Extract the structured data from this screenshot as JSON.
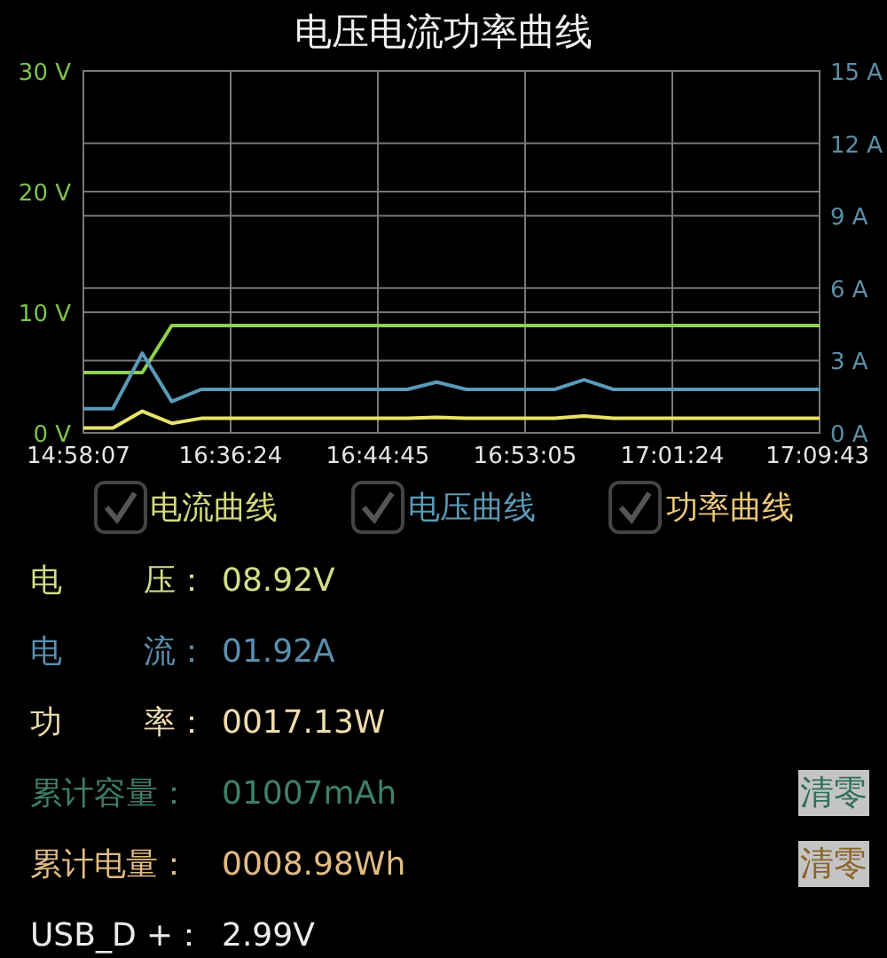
{
  "title": "电压电流功率曲线",
  "chart": {
    "chart_data": {
      "type": "line",
      "grid": true,
      "categories": [
        "14:58:07",
        null,
        null,
        null,
        null,
        "16:36:24",
        null,
        null,
        null,
        null,
        "16:44:45",
        null,
        null,
        null,
        null,
        "16:53:05",
        null,
        null,
        null,
        null,
        "17:01:24",
        null,
        null,
        null,
        null,
        "17:09:43"
      ],
      "ylim": [
        0,
        30
      ],
      "yticks": [
        {
          "value": 0,
          "label": "0 V"
        },
        {
          "value": 10,
          "label": "10 V"
        },
        {
          "value": 20,
          "label": "20 V"
        },
        {
          "value": 30,
          "label": "30 V"
        }
      ],
      "y2lim": [
        0,
        15
      ],
      "y2ticks": [
        {
          "value": 0,
          "label": "0 A"
        },
        {
          "value": 3,
          "label": "3 A"
        },
        {
          "value": 6,
          "label": "6 A"
        },
        {
          "value": 9,
          "label": "9 A"
        },
        {
          "value": 12,
          "label": "12 A"
        },
        {
          "value": 15,
          "label": "15 A"
        }
      ],
      "series": [
        {
          "color": "#8fd14f",
          "values": [
            5,
            5,
            5,
            8.9,
            8.9,
            8.9,
            8.9,
            8.9,
            8.9,
            8.9,
            8.9,
            8.9,
            8.9,
            8.9,
            8.9,
            8.9,
            8.9,
            8.9,
            8.9,
            8.9,
            8.9,
            8.9,
            8.9,
            8.9,
            8.9,
            8.9
          ]
        },
        {
          "color": "#5b9ab8",
          "axis": "y2",
          "values": [
            1.0,
            1.0,
            3.3,
            1.3,
            1.8,
            1.8,
            1.8,
            1.8,
            1.8,
            1.8,
            1.8,
            1.8,
            2.1,
            1.8,
            1.8,
            1.8,
            1.8,
            2.2,
            1.8,
            1.8,
            1.8,
            1.8,
            1.8,
            1.8,
            1.8,
            1.8
          ]
        },
        {
          "color": "#e9e36a",
          "values": [
            0.4,
            0.4,
            1.8,
            0.8,
            1.2,
            1.2,
            1.2,
            1.2,
            1.2,
            1.2,
            1.2,
            1.2,
            1.3,
            1.2,
            1.2,
            1.2,
            1.2,
            1.4,
            1.2,
            1.2,
            1.2,
            1.2,
            1.2,
            1.2,
            1.2,
            1.2
          ]
        }
      ]
    }
  },
  "toggles": [
    {
      "label": "电流曲线",
      "checked": true,
      "color": "#d4dd7e"
    },
    {
      "label": "电压曲线",
      "checked": true,
      "color": "#5b9ab8"
    },
    {
      "label": "功率曲线",
      "checked": true,
      "color": "#f0c97a"
    }
  ],
  "readings": [
    {
      "label": [
        "电",
        "压："
      ],
      "value": "08.92V",
      "color": "#d4dd8a"
    },
    {
      "label": [
        "电",
        "流："
      ],
      "value": "01.92A",
      "color": "#5a8fae"
    },
    {
      "label": [
        "功",
        "率："
      ],
      "value": "0017.13W",
      "color": "#f0dcae"
    },
    {
      "label": [
        "累计容量："
      ],
      "value": "01007mAh",
      "color": "#3f7f6c",
      "button": {
        "label": "清零",
        "color": "#2f6f5c"
      }
    },
    {
      "label": [
        "累计电量："
      ],
      "value": "0008.98Wh",
      "color": "#e2bb85",
      "button": {
        "label": "清零",
        "color": "#8a6428"
      }
    },
    {
      "label": [
        "USB_D +："
      ],
      "value": "2.99V",
      "color": "#ececec"
    }
  ]
}
